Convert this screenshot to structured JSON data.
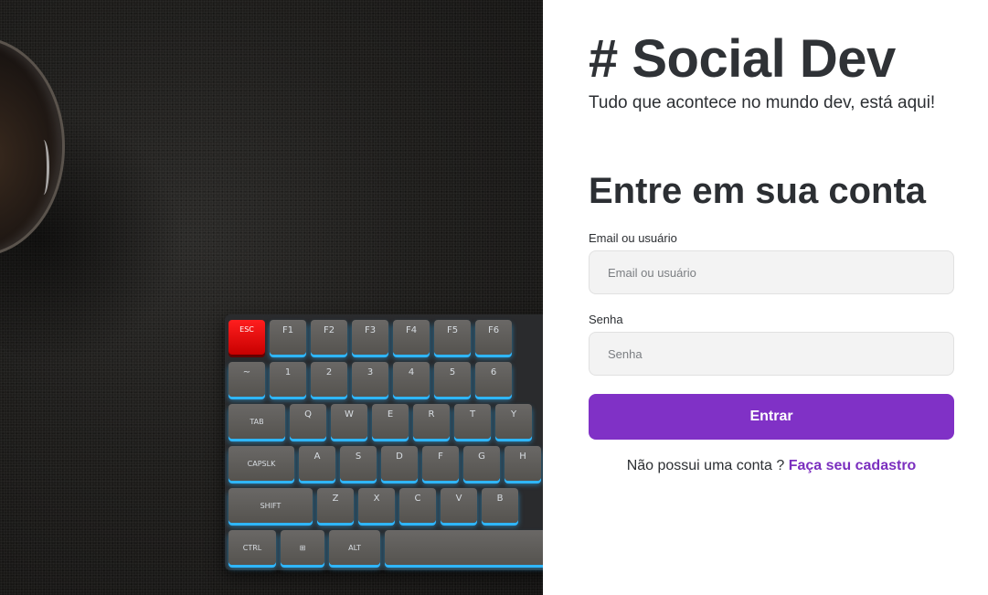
{
  "hero": {
    "keyboard_keys": {
      "row1": [
        "ESC",
        "F1",
        "F2",
        "F3",
        "F4",
        "F5",
        "F6"
      ],
      "row2": [
        "~",
        "1",
        "2",
        "3",
        "4",
        "5",
        "6"
      ],
      "row3": [
        "TAB",
        "Q",
        "W",
        "E",
        "R",
        "T",
        "Y"
      ],
      "row4": [
        "CAPSLK",
        "A",
        "S",
        "D",
        "F",
        "G",
        "H"
      ],
      "row5": [
        "SHIFT",
        "Z",
        "X",
        "C",
        "V",
        "B"
      ],
      "row6": [
        "CTRL",
        "⊞",
        "ALT",
        ""
      ]
    }
  },
  "brand": {
    "title": "# Social Dev",
    "tagline": "Tudo que acontece no mundo dev, está aqui!"
  },
  "login": {
    "heading": "Entre em sua conta",
    "email_label": "Email ou usuário",
    "email_placeholder": "Email ou usuário",
    "email_value": "",
    "password_label": "Senha",
    "password_placeholder": "Senha",
    "password_value": "",
    "submit_label": "Entrar",
    "signup_prompt": "Não possui uma conta ?",
    "signup_link": "Faça seu cadastro"
  },
  "colors": {
    "accent": "#8031c6",
    "link": "#7b2fbf",
    "input_bg": "#f3f3f3",
    "text": "#2c2f33"
  }
}
